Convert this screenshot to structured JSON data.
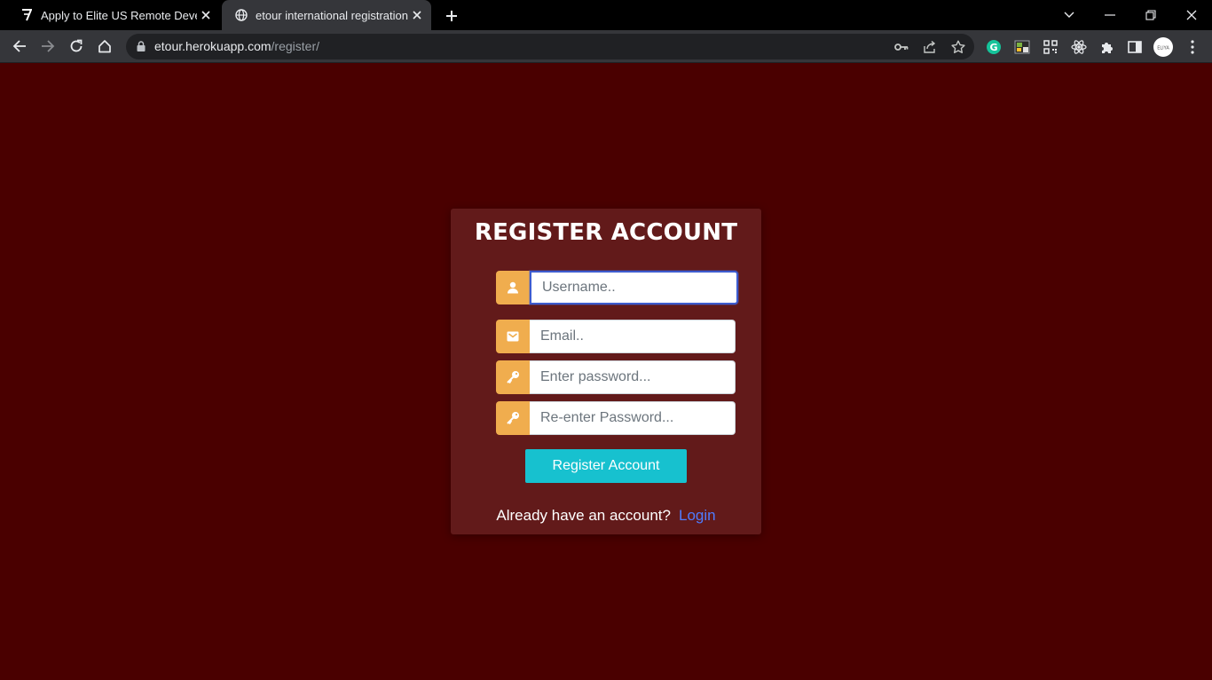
{
  "browser": {
    "tabs": [
      {
        "title": "Apply to Elite US Remote Developer Jobs",
        "active": false,
        "favicon": "turing-logo-icon"
      },
      {
        "title": "etour international registration",
        "active": true,
        "favicon": "globe-icon"
      }
    ],
    "url_host": "etour.herokuapp.com",
    "url_path": "/register/",
    "profile_initials": "ELIYA"
  },
  "page": {
    "background_color": "#4a0000",
    "card_color": "#621a1a",
    "accent_color": "#f0ad4e",
    "button_color": "#17c1cf",
    "link_color": "#4f7cff"
  },
  "form": {
    "title": "REGISTER ACCOUNT",
    "username_placeholder": "Username..",
    "email_placeholder": "Email..",
    "password_placeholder": "Enter password...",
    "repassword_placeholder": "Re-enter Password...",
    "submit_label": "Register Account",
    "footer_text": "Already have an account?",
    "login_link": "Login"
  }
}
